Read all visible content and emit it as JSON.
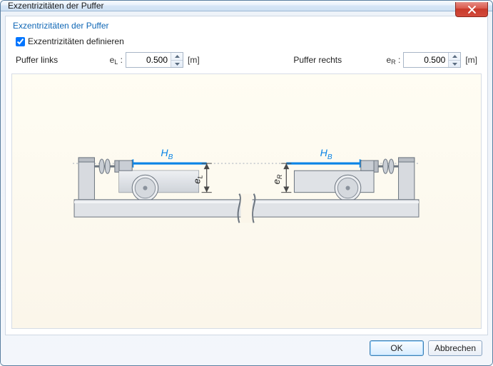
{
  "window": {
    "title": "Exzentrizitäten der Puffer"
  },
  "section": {
    "title": "Exzentrizitäten der Puffer"
  },
  "checkbox": {
    "label": "Exzentrizitäten definieren",
    "checked": true
  },
  "left": {
    "label": "Puffer links",
    "symbol_main": "e",
    "symbol_sub": "L",
    "colon": ":",
    "value": "0.500",
    "unit": "[m]"
  },
  "right": {
    "label": "Puffer rechts",
    "symbol_main": "e",
    "symbol_sub": "R",
    "colon": ":",
    "value": "0.500",
    "unit": "[m]"
  },
  "diagram": {
    "hb_left_label": "H",
    "hb_left_sub": "B",
    "hb_right_label": "H",
    "hb_right_sub": "B",
    "el_main": "e",
    "el_sub": "L",
    "er_main": "e",
    "er_sub": "R"
  },
  "buttons": {
    "ok": "OK",
    "cancel": "Abbrechen"
  }
}
